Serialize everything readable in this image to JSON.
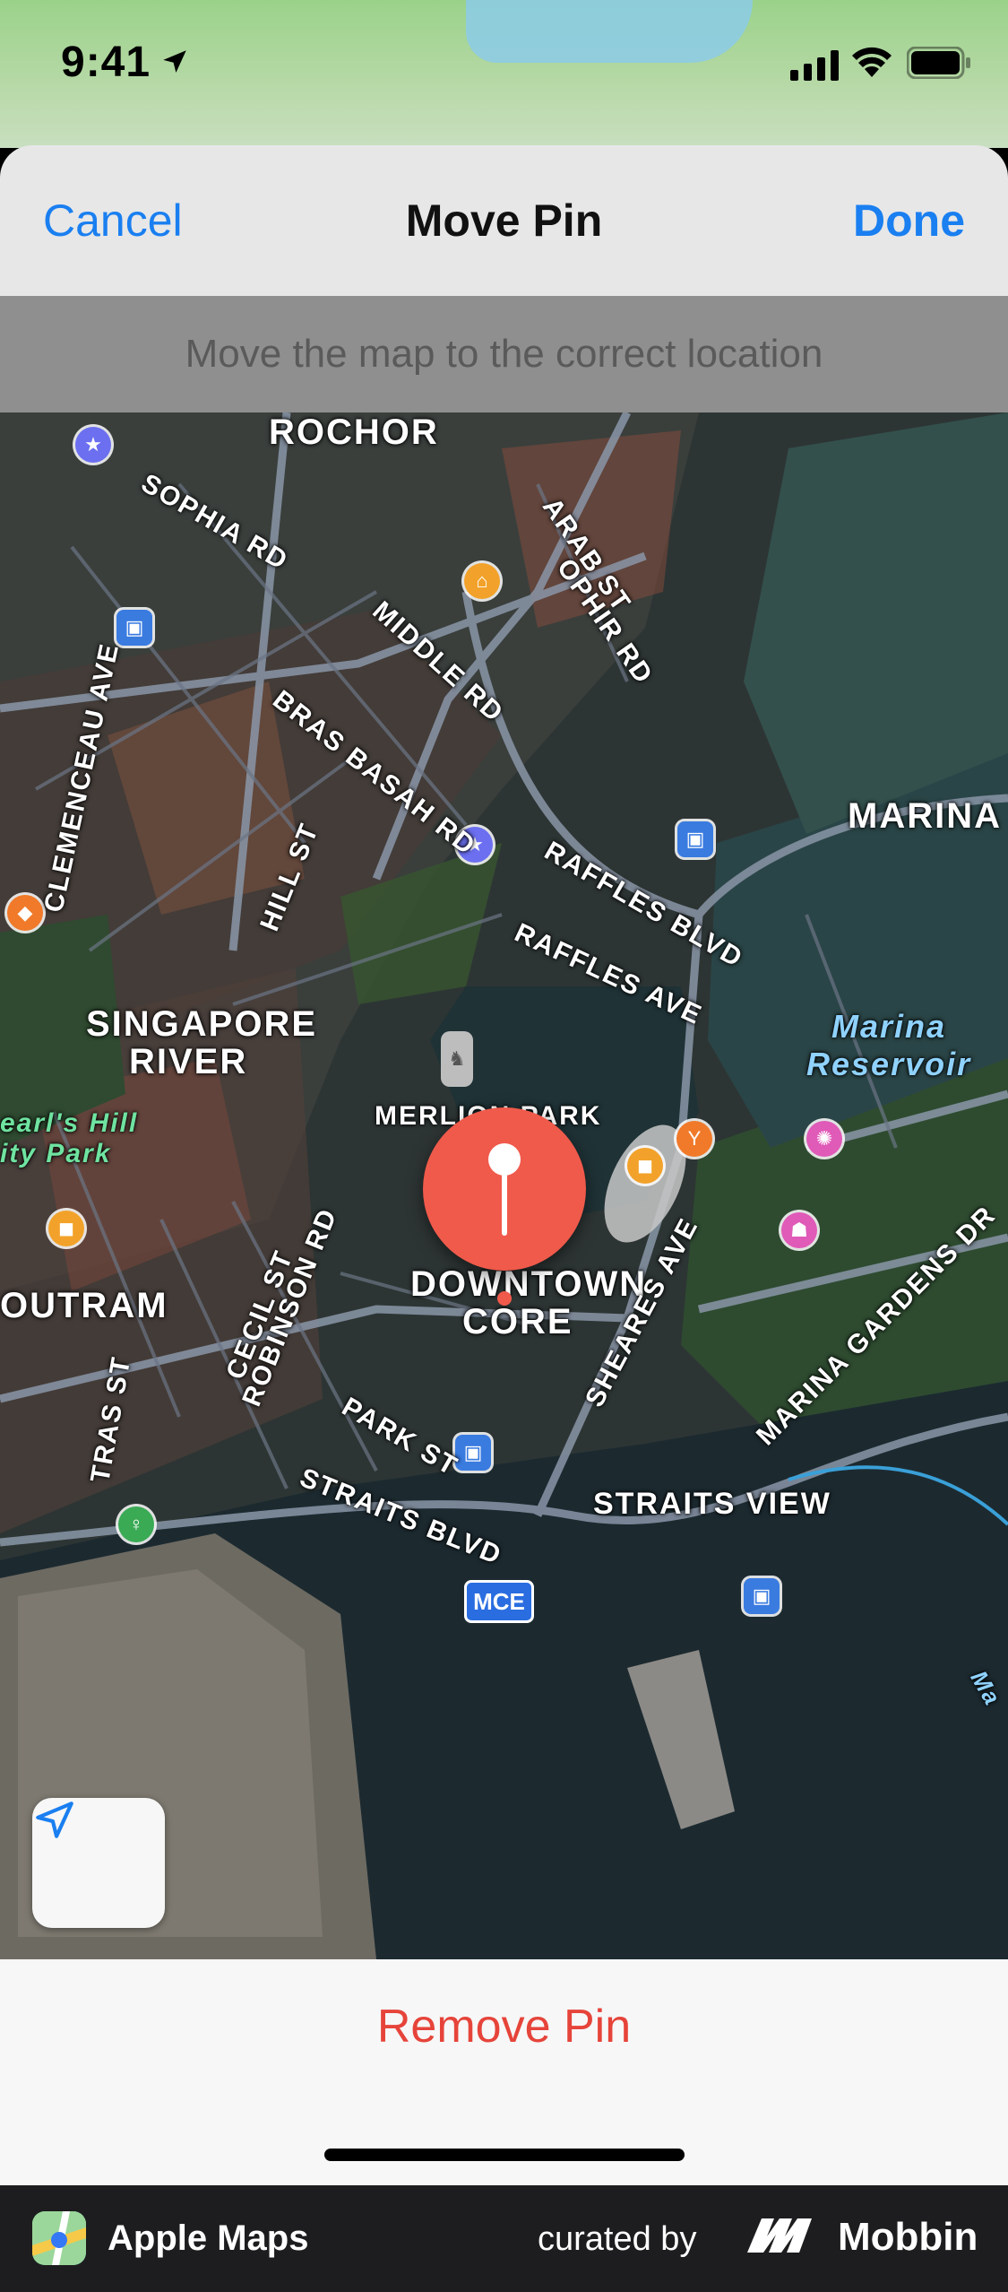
{
  "status_bar": {
    "time": "9:41"
  },
  "nav": {
    "cancel": "Cancel",
    "title": "Move Pin",
    "done": "Done"
  },
  "hint": "Move the map to the correct location",
  "map_labels": {
    "rochor": "ROCHOR",
    "sophia": "SOPHIA RD",
    "arab": "ARAB ST",
    "ophir": "OPHIR RD",
    "middle": "MIDDLE RD",
    "bras_basah": "BRAS BASAH RD",
    "clemenceau": "CLEMENCEAU AVE",
    "hill": "HILL ST",
    "raffles_blvd": "RAFFLES BLVD",
    "raffles_ave": "RAFFLES AVE",
    "marina_east": "MARINA EA",
    "marina_reservoir_1": "Marina",
    "marina_reservoir_2": "Reservoir",
    "singapore_river_1": "SINGAPORE",
    "singapore_river_2": "RIVER",
    "pearls_1": "earl's Hill",
    "pearls_2": "ity Park",
    "merlion": "MERLION PARK",
    "downtown_1": "DOWNTOWN",
    "downtown_2": "CORE",
    "outram": "OUTRAM",
    "cecil": "CECIL ST",
    "robinson": "ROBINSON RD",
    "sheares": "SHEARES AVE",
    "marina_gardens": "MARINA GARDENS DR",
    "tras": "TRAS ST",
    "park": "PARK ST",
    "straits_blvd": "STRAITS BLVD",
    "straits_view": "STRAITS VIEW",
    "mce": "MCE",
    "ma": "Ma"
  },
  "remove_pin": "Remove Pin",
  "footer": {
    "app_name": "Apple Maps",
    "curated": "curated by",
    "brand": "Mobbin"
  },
  "colors": {
    "accent": "#1a7ff0",
    "destructive": "#e6443a",
    "pin": "#f05a4b"
  }
}
